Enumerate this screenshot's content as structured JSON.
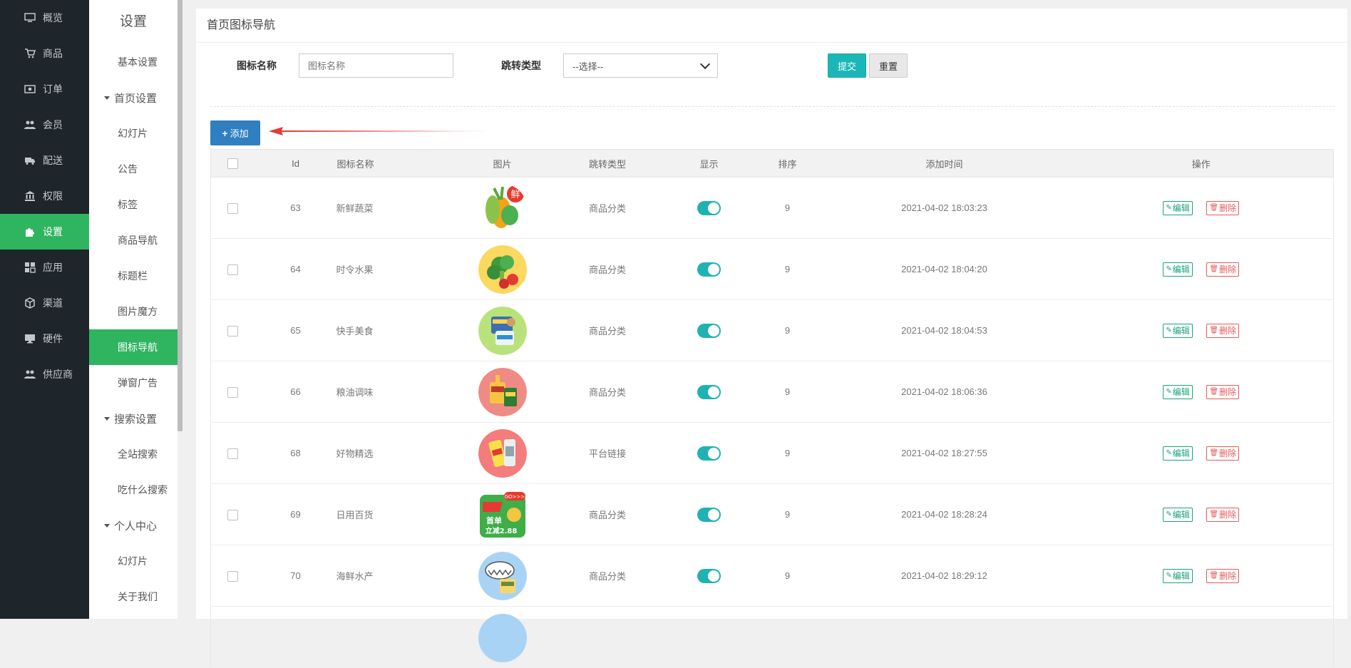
{
  "main_nav": [
    {
      "label": "概览",
      "icon": "monitor-icon",
      "active": false
    },
    {
      "label": "商品",
      "icon": "cart-icon",
      "active": false
    },
    {
      "label": "订单",
      "icon": "money-icon",
      "active": false
    },
    {
      "label": "会员",
      "icon": "users-icon",
      "active": false
    },
    {
      "label": "配送",
      "icon": "truck-icon",
      "active": false
    },
    {
      "label": "权限",
      "icon": "bank-icon",
      "active": false
    },
    {
      "label": "设置",
      "icon": "puzzle-icon",
      "active": true
    },
    {
      "label": "应用",
      "icon": "apps-icon",
      "active": false
    },
    {
      "label": "渠道",
      "icon": "cube-icon",
      "active": false
    },
    {
      "label": "硬件",
      "icon": "desktop-icon",
      "active": false
    },
    {
      "label": "供应商",
      "icon": "supplier-icon",
      "active": false
    }
  ],
  "sub_nav": {
    "title": "设置",
    "items": [
      {
        "type": "item",
        "label": "基本设置"
      },
      {
        "type": "group",
        "label": "首页设置"
      },
      {
        "type": "item",
        "label": "幻灯片"
      },
      {
        "type": "item",
        "label": "公告"
      },
      {
        "type": "item",
        "label": "标签"
      },
      {
        "type": "item",
        "label": "商品导航"
      },
      {
        "type": "item",
        "label": "标题栏"
      },
      {
        "type": "item",
        "label": "图片魔方"
      },
      {
        "type": "item",
        "label": "图标导航",
        "active": true
      },
      {
        "type": "item",
        "label": "弹窗广告"
      },
      {
        "type": "group",
        "label": "搜索设置"
      },
      {
        "type": "item",
        "label": "全站搜索"
      },
      {
        "type": "item",
        "label": "吃什么搜索"
      },
      {
        "type": "group",
        "label": "个人中心"
      },
      {
        "type": "item",
        "label": "幻灯片"
      },
      {
        "type": "item",
        "label": "关于我们"
      }
    ]
  },
  "page": {
    "title": "首页图标导航"
  },
  "filter": {
    "name_label": "图标名称",
    "name_placeholder": "图标名称",
    "type_label": "跳转类型",
    "type_selected": "--选择--",
    "submit_label": "提交",
    "reset_label": "重置"
  },
  "add_label": "添加",
  "table": {
    "headers": [
      "",
      "Id",
      "图标名称",
      "图片",
      "跳转类型",
      "显示",
      "排序",
      "添加时间",
      "操作"
    ],
    "edit_label": "编辑",
    "delete_label": "删除",
    "rows": [
      {
        "id": "63",
        "name": "新鲜蔬菜",
        "type": "商品分类",
        "sort": "9",
        "time": "2021-04-02 18:03:23",
        "show": true,
        "img": "veg"
      },
      {
        "id": "64",
        "name": "时令水果",
        "type": "商品分类",
        "sort": "9",
        "time": "2021-04-02 18:04:20",
        "show": true,
        "img": "fruit"
      },
      {
        "id": "65",
        "name": "快手美食",
        "type": "商品分类",
        "sort": "9",
        "time": "2021-04-02 18:04:53",
        "show": true,
        "img": "food"
      },
      {
        "id": "66",
        "name": "粮油调味",
        "type": "商品分类",
        "sort": "9",
        "time": "2021-04-02 18:06:36",
        "show": true,
        "img": "oil"
      },
      {
        "id": "68",
        "name": "好物精选",
        "type": "平台链接",
        "sort": "9",
        "time": "2021-04-02 18:27:55",
        "show": true,
        "img": "goods"
      },
      {
        "id": "69",
        "name": "日用百货",
        "type": "商品分类",
        "sort": "9",
        "time": "2021-04-02 18:28:24",
        "show": true,
        "img": "daily"
      },
      {
        "id": "70",
        "name": "海鲜水产",
        "type": "商品分类",
        "sort": "9",
        "time": "2021-04-02 18:29:12",
        "show": true,
        "img": "seafood"
      }
    ]
  },
  "thumb_text": {
    "veg_badge": "鲜",
    "daily_badge": "GO>>>",
    "daily_line1": "首单",
    "daily_line2": "立减2.88"
  },
  "colors": {
    "sidebar_bg": "#1e252b",
    "active_green": "#2fb460",
    "accent_teal": "#1bb7b7",
    "add_blue": "#2f7fc1"
  }
}
